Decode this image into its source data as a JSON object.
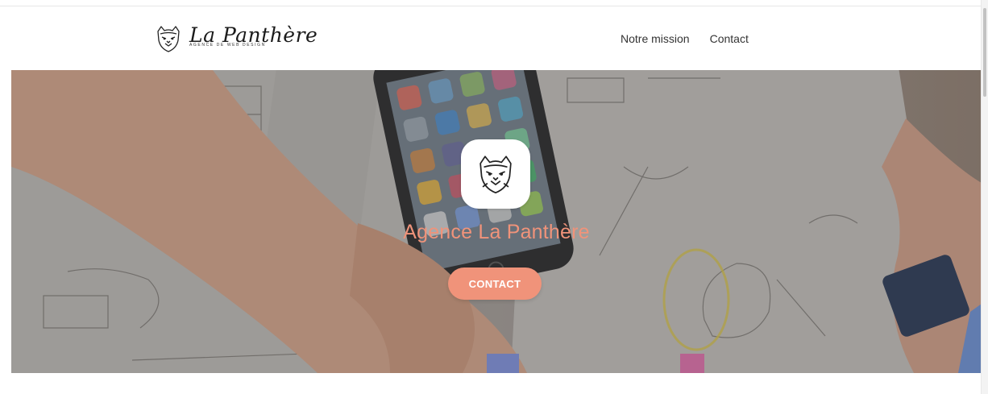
{
  "brand": {
    "name": "La Panthère",
    "tagline": "AGENCE DE WEB DESIGN",
    "logo_icon": "panther-head-icon"
  },
  "nav": {
    "items": [
      {
        "label": "Notre mission"
      },
      {
        "label": "Contact"
      }
    ]
  },
  "hero": {
    "title": "Agence La Panthère",
    "button_label": "CONTACT",
    "badge_icon": "panther-head-icon"
  },
  "colors": {
    "accent": "#f0937a",
    "text": "#333333",
    "background": "#ffffff"
  }
}
